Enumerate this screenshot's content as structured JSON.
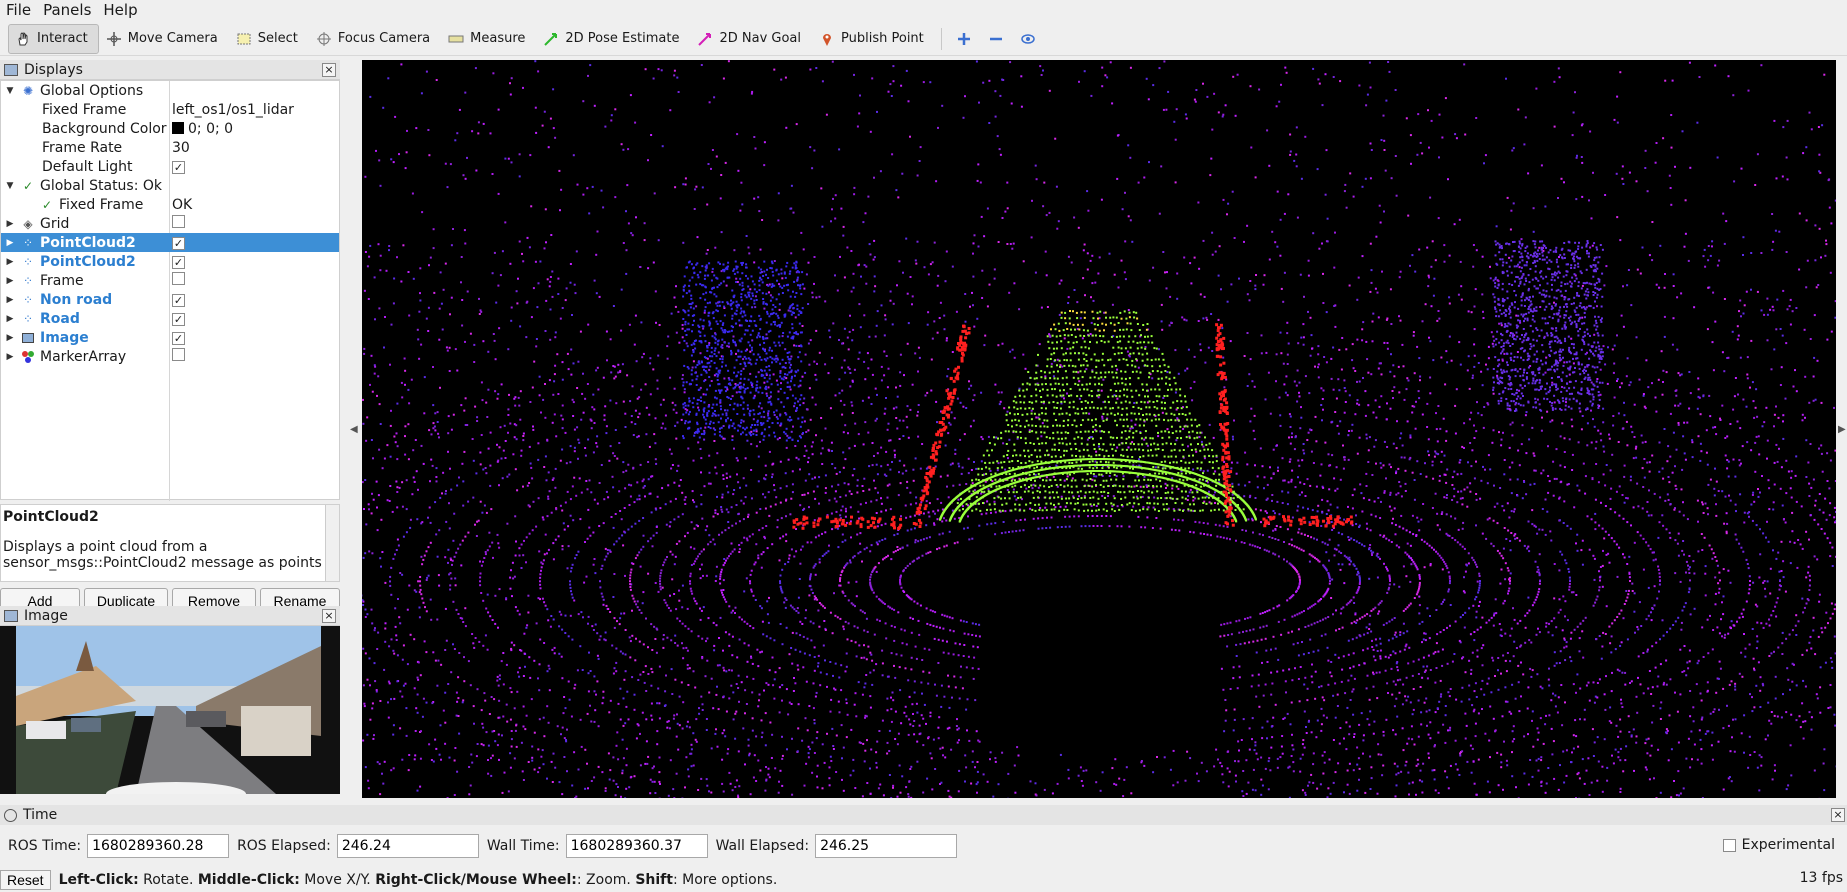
{
  "menu": {
    "file": "File",
    "panels": "Panels",
    "help": "Help"
  },
  "toolbar": {
    "interact": "Interact",
    "move_camera": "Move Camera",
    "select": "Select",
    "focus_camera": "Focus Camera",
    "measure": "Measure",
    "pose_estimate": "2D Pose Estimate",
    "nav_goal": "2D Nav Goal",
    "publish_point": "Publish Point"
  },
  "displays": {
    "title": "Displays",
    "rows": {
      "global_options": "Global Options",
      "fixed_frame": {
        "label": "Fixed Frame",
        "value": "left_os1/os1_lidar"
      },
      "background_color": {
        "label": "Background Color",
        "value": "0; 0; 0"
      },
      "frame_rate": {
        "label": "Frame Rate",
        "value": "30"
      },
      "default_light": {
        "label": "Default Light",
        "checked": true
      },
      "global_status": "Global Status: Ok",
      "status_fixed_frame": {
        "label": "Fixed Frame",
        "value": "OK"
      },
      "items": [
        {
          "label": "Grid",
          "checked": false,
          "icon": "grid-icon"
        },
        {
          "label": "PointCloud2",
          "checked": true,
          "icon": "pointcloud-icon",
          "selected": true
        },
        {
          "label": "PointCloud2",
          "checked": true,
          "icon": "pointcloud-icon"
        },
        {
          "label": "Frame",
          "checked": false,
          "icon": "pointcloud-icon"
        },
        {
          "label": "Non road",
          "checked": true,
          "icon": "pointcloud-icon"
        },
        {
          "label": "Road",
          "checked": true,
          "icon": "pointcloud-icon"
        },
        {
          "label": "Image",
          "checked": true,
          "icon": "image-icon"
        },
        {
          "label": "MarkerArray",
          "checked": false,
          "icon": "marker-array-icon"
        }
      ]
    },
    "description": {
      "title": "PointCloud2",
      "text": "Displays a point cloud from a sensor_msgs::PointCloud2 message as points"
    },
    "buttons": {
      "add": "Add",
      "duplicate": "Duplicate",
      "remove": "Remove",
      "rename": "Rename"
    }
  },
  "image_panel": {
    "title": "Image"
  },
  "time": {
    "title": "Time",
    "ros_time_label": "ROS Time:",
    "ros_time": "1680289360.28",
    "ros_elapsed_label": "ROS Elapsed:",
    "ros_elapsed": "246.24",
    "wall_time_label": "Wall Time:",
    "wall_time": "1680289360.37",
    "wall_elapsed_label": "Wall Elapsed:",
    "wall_elapsed": "246.25",
    "experimental": "Experimental"
  },
  "status": {
    "reset": "Reset",
    "left_click": "Left-Click:",
    "left_click_desc": " Rotate. ",
    "middle_click": "Middle-Click:",
    "middle_click_desc": " Move X/Y. ",
    "right_click": "Right-Click/Mouse Wheel:",
    "right_click_desc": ": Zoom. ",
    "shift": "Shift",
    "shift_desc": ": More options.",
    "fps": "13 fps"
  },
  "colors": {
    "selection": "#3d8fd6",
    "road": "#9aff3c",
    "nonroad": "#c020ff",
    "edge": "#ff2020"
  }
}
